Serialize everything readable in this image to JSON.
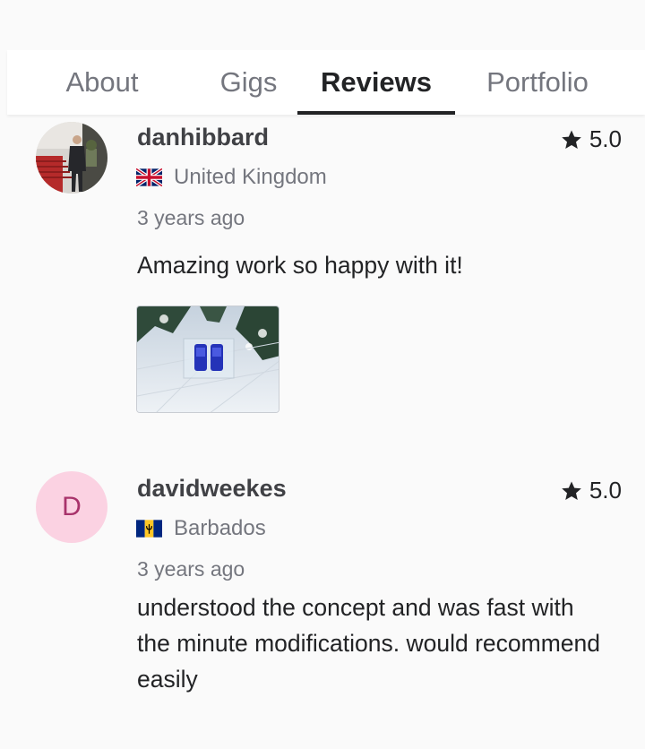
{
  "tabs": [
    {
      "label": "About"
    },
    {
      "label": "Gigs"
    },
    {
      "label": "Reviews"
    },
    {
      "label": "Portfolio"
    }
  ],
  "reviews": [
    {
      "username": "danhibbard",
      "rating": "5.0",
      "country": "United Kingdom",
      "flag_icon": "uk-flag-icon",
      "time": "3 years ago",
      "text": "Amazing work so happy with it!",
      "has_attachment": true
    },
    {
      "username": "davidweekes",
      "avatar_letter": "D",
      "rating": "5.0",
      "country": "Barbados",
      "flag_icon": "barbados-flag-icon",
      "time": "3 years ago",
      "text": "understood the concept and was fast with the minute modifications. would recommend easily",
      "has_attachment": false
    }
  ],
  "colors": {
    "active_tab": "#222325",
    "inactive_tab": "#74767e",
    "avatar_bg": "#fbd2e2",
    "avatar_letter": "#a8336b"
  }
}
